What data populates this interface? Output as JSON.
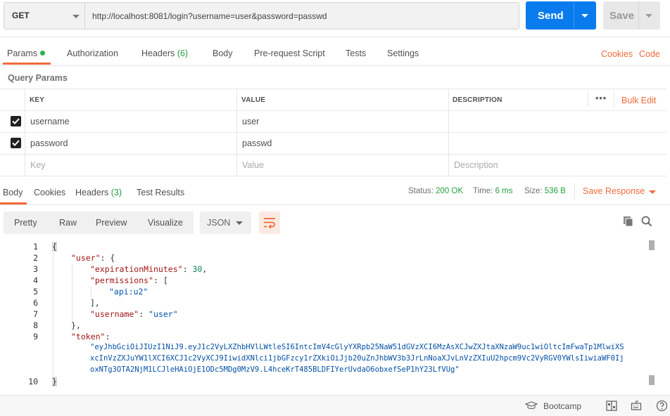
{
  "request": {
    "method": "GET",
    "url": "http://localhost:8081/login?username=user&password=passwd",
    "send_label": "Send",
    "save_label": "Save"
  },
  "request_tabs": {
    "params": "Params",
    "authorization": "Authorization",
    "headers": "Headers",
    "headers_count": "(6)",
    "body": "Body",
    "pre_request_script": "Pre-request Script",
    "tests": "Tests",
    "settings": "Settings",
    "cookies": "Cookies",
    "code": "Code"
  },
  "query_params": {
    "title": "Query Params",
    "columns": {
      "key": "KEY",
      "value": "VALUE",
      "description": "DESCRIPTION"
    },
    "bulk_edit": "Bulk Edit",
    "more": "•••",
    "rows": [
      {
        "key": "username",
        "value": "user",
        "checked": true
      },
      {
        "key": "password",
        "value": "passwd",
        "checked": true
      }
    ],
    "placeholder": {
      "key": "Key",
      "value": "Value",
      "description": "Description"
    }
  },
  "response_tabs": {
    "body": "Body",
    "cookies": "Cookies",
    "headers": "Headers",
    "headers_count": "(3)",
    "test_results": "Test Results"
  },
  "response_meta": {
    "status_label": "Status:",
    "status_value": "200 OK",
    "time_label": "Time:",
    "time_value": "6 ms",
    "size_label": "Size:",
    "size_value": "536 B",
    "save_response": "Save Response"
  },
  "view_modes": [
    "Pretty",
    "Raw",
    "Preview",
    "Visualize"
  ],
  "format": "JSON",
  "line_numbers": [
    "1",
    "2",
    "3",
    "4",
    "5",
    "6",
    "7",
    "8",
    "9",
    "10"
  ],
  "response_body": {
    "l1": "{",
    "user_key": "\"user\"",
    "exp_key": "\"expirationMinutes\"",
    "exp_val": "30",
    "perm_key": "\"permissions\"",
    "perm_item": "\"api:u2\"",
    "username_key": "\"username\"",
    "username_val": "\"user\"",
    "token_key": "\"token\"",
    "token_l1": "\"eyJhbGciOiJIUzI1NiJ9.eyJ1c2VyLXZhbHVlLWtleSI6IntcImV4cGlyYXRpb25NaW51dGVzXCI6MzAsXCJwZXJtaXNzaW9uc1wiOltcImFwaTp1MlwiXS",
    "token_l2": "xcInVzZXJuYW1lXCI6XCJ1c2VyXCJ9IiwidXNlci1jbGFzcy1rZXkiOiJjb20uZnJhbWV3b3JrLnNoaXJvLnVzZXIuU2hpcm9Vc2VyRGV0YWlsIiwiaWF0Ij",
    "token_l3": "oxNTg3OTA2NjM1LCJleHAiOjE1ODc5MDg0MzV9.L4hceKrT485BLDFIYerUvdaO6obxefSeP1hY23LfVUg\"",
    "l10": "}"
  },
  "footer": {
    "bootcamp": "Bootcamp"
  }
}
